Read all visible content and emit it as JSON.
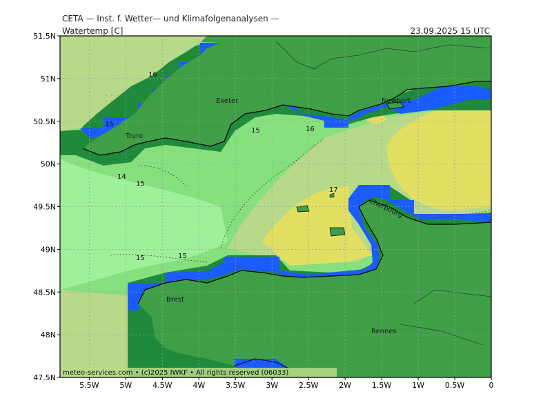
{
  "header": {
    "source": "CETA — Inst. f. Wetter— und Klimafolgenanalysen —",
    "variable": "Watertemp [C]",
    "valid_time": "23.09.2025 15 UTC"
  },
  "footer": {
    "copyright": "meteo-services.com • (c)2025 IWKF • All rights reserved (06033)"
  },
  "map": {
    "lon_range": [
      -5.9,
      0.0
    ],
    "lat_range": [
      47.5,
      51.5
    ],
    "lon_ticks": [
      "5.5W",
      "5W",
      "4.5W",
      "4W",
      "3.5W",
      "3W",
      "2.5W",
      "2W",
      "1.5W",
      "1W",
      "0.5W",
      "0"
    ],
    "lat_ticks": [
      "51.5N",
      "51N",
      "50.5N",
      "50N",
      "49.5N",
      "49N",
      "48.5N",
      "48N",
      "47.5N"
    ],
    "cities": [
      "Exeter",
      "Truro",
      "Newport",
      "Cherbourg",
      "Brest",
      "Rennes"
    ],
    "contour_labels": [
      "16",
      "15",
      "15",
      "16",
      "14",
      "15",
      "17",
      "15",
      "15"
    ]
  },
  "colors": {
    "land": "#3f9f47",
    "coast_dark": "#1f8a3c",
    "coast_blue": "#1a5cff",
    "sea_14": "#9ef09a",
    "sea_15": "#86e07e",
    "sea_16": "#b8d98a",
    "sea_17": "#e2e062"
  }
}
